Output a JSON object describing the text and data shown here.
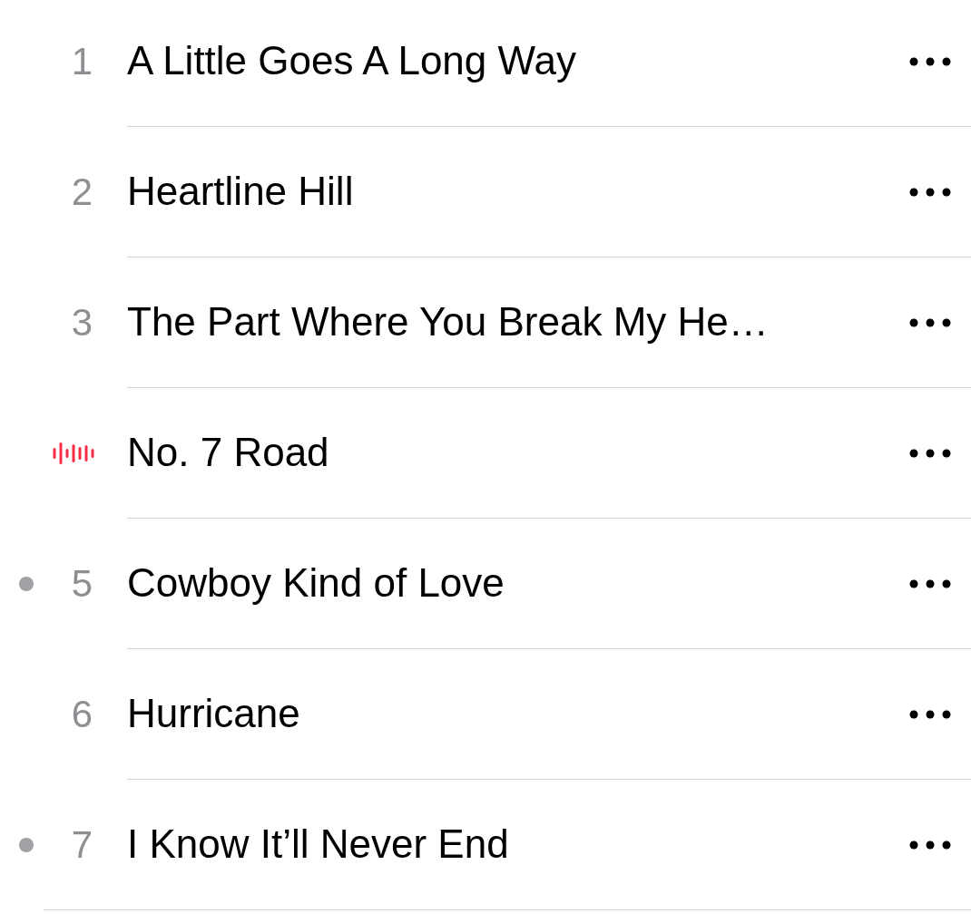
{
  "tracks": [
    {
      "number": "1",
      "title": "A Little Goes A Long Way",
      "playing": false,
      "marked": false
    },
    {
      "number": "2",
      "title": "Heartline Hill",
      "playing": false,
      "marked": false
    },
    {
      "number": "3",
      "title": "The Part Where You Break My He…",
      "playing": false,
      "marked": false
    },
    {
      "title": "No. 7 Road",
      "playing": true,
      "marked": false
    },
    {
      "number": "5",
      "title": "Cowboy Kind of Love",
      "playing": false,
      "marked": true
    },
    {
      "number": "6",
      "title": "Hurricane",
      "playing": false,
      "marked": false
    },
    {
      "number": "7",
      "title": "I Know It’ll Never End",
      "playing": false,
      "marked": true
    }
  ]
}
